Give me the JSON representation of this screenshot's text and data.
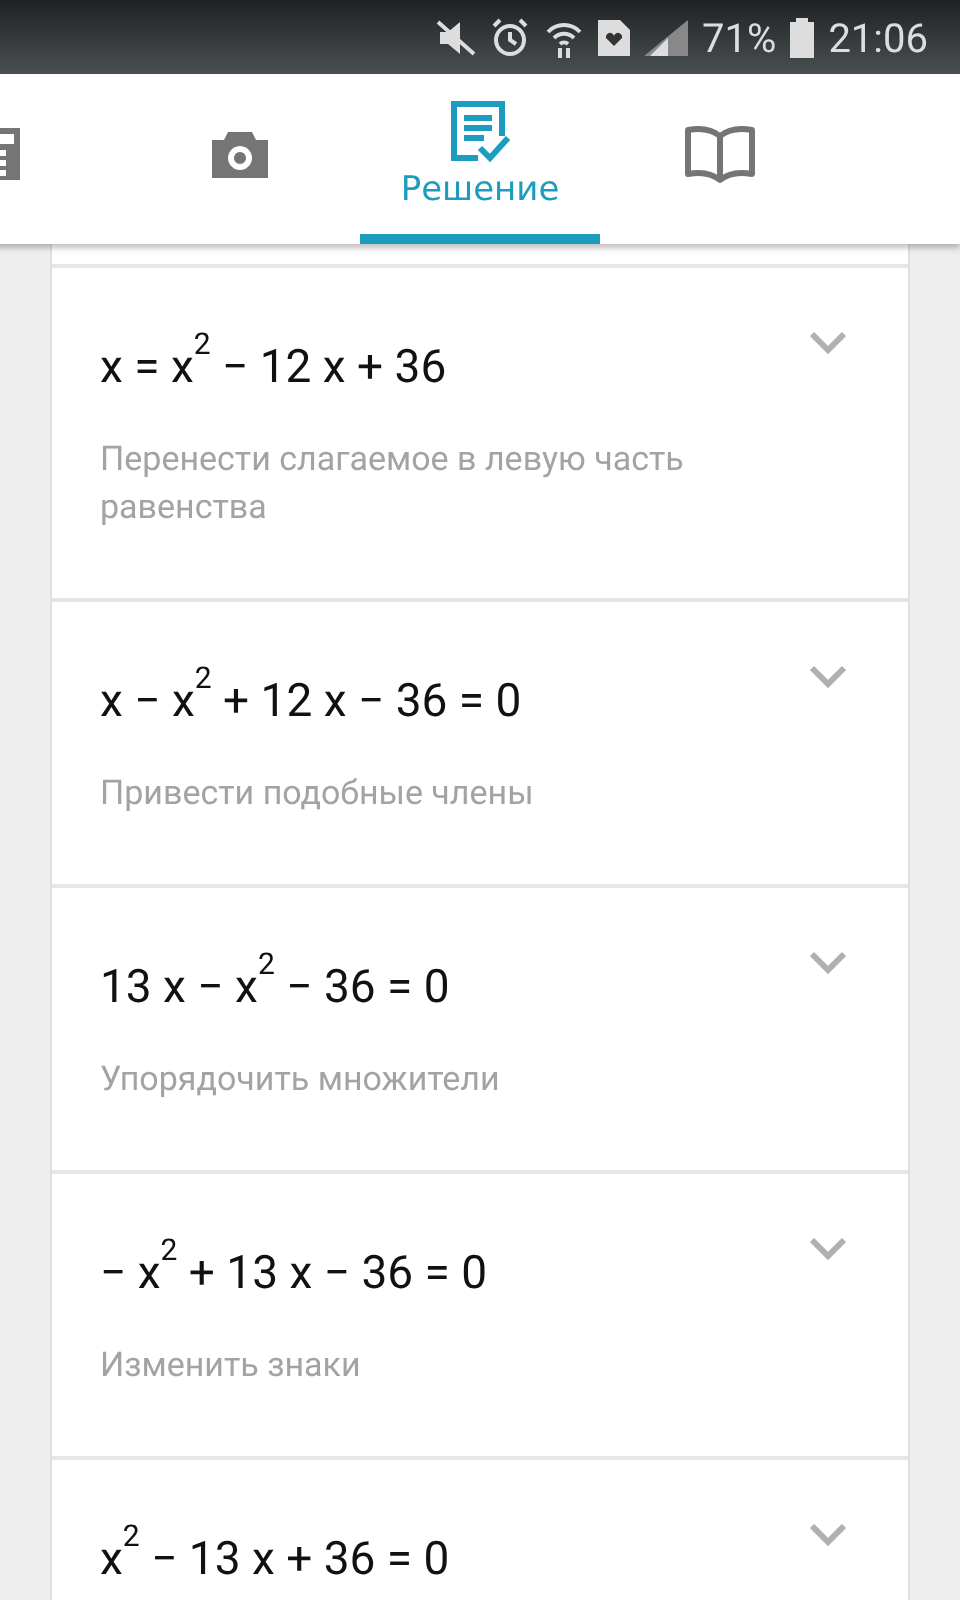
{
  "status_bar": {
    "battery": "71%",
    "time": "21:06"
  },
  "tabs": [
    {
      "kind": "calculator",
      "selected": false
    },
    {
      "kind": "camera",
      "selected": false
    },
    {
      "kind": "solution",
      "label": "Решение",
      "selected": true
    },
    {
      "kind": "book",
      "selected": false
    }
  ],
  "steps": [
    {
      "equation": "x = x$^{2}$ − 12 x + 36",
      "explanation": "Перенести слагаемое в левую часть равенства",
      "expanded": false
    },
    {
      "equation": "x − x$^{2}$ + 12 x − 36 = 0",
      "explanation": "Привести подобные члены",
      "expanded": false
    },
    {
      "equation": "13 x − x$^{2}$ − 36 = 0",
      "explanation": "Упорядочить множители",
      "expanded": false
    },
    {
      "equation": "− x$^{2}$ + 13 x − 36 = 0",
      "explanation": "Изменить знаки",
      "expanded": false
    },
    {
      "equation": "x$^{2}$ − 13 x + 36 = 0",
      "expanded": false
    }
  ]
}
